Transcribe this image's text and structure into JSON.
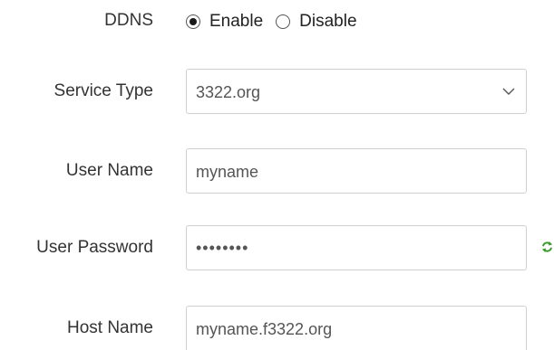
{
  "ddns": {
    "label": "DDNS",
    "options": [
      {
        "label": "Enable",
        "selected": true
      },
      {
        "label": "Disable",
        "selected": false
      }
    ]
  },
  "service_type": {
    "label": "Service Type",
    "value": "3322.org",
    "icon": "chevron-down-icon"
  },
  "user_name": {
    "label": "User Name",
    "value": "myname"
  },
  "user_password": {
    "label": "User Password",
    "value": "••••••••",
    "icon": "refresh-icon",
    "icon_color": "#3a9a2e"
  },
  "host_name": {
    "label": "Host Name",
    "value": "myname.f3322.org"
  }
}
